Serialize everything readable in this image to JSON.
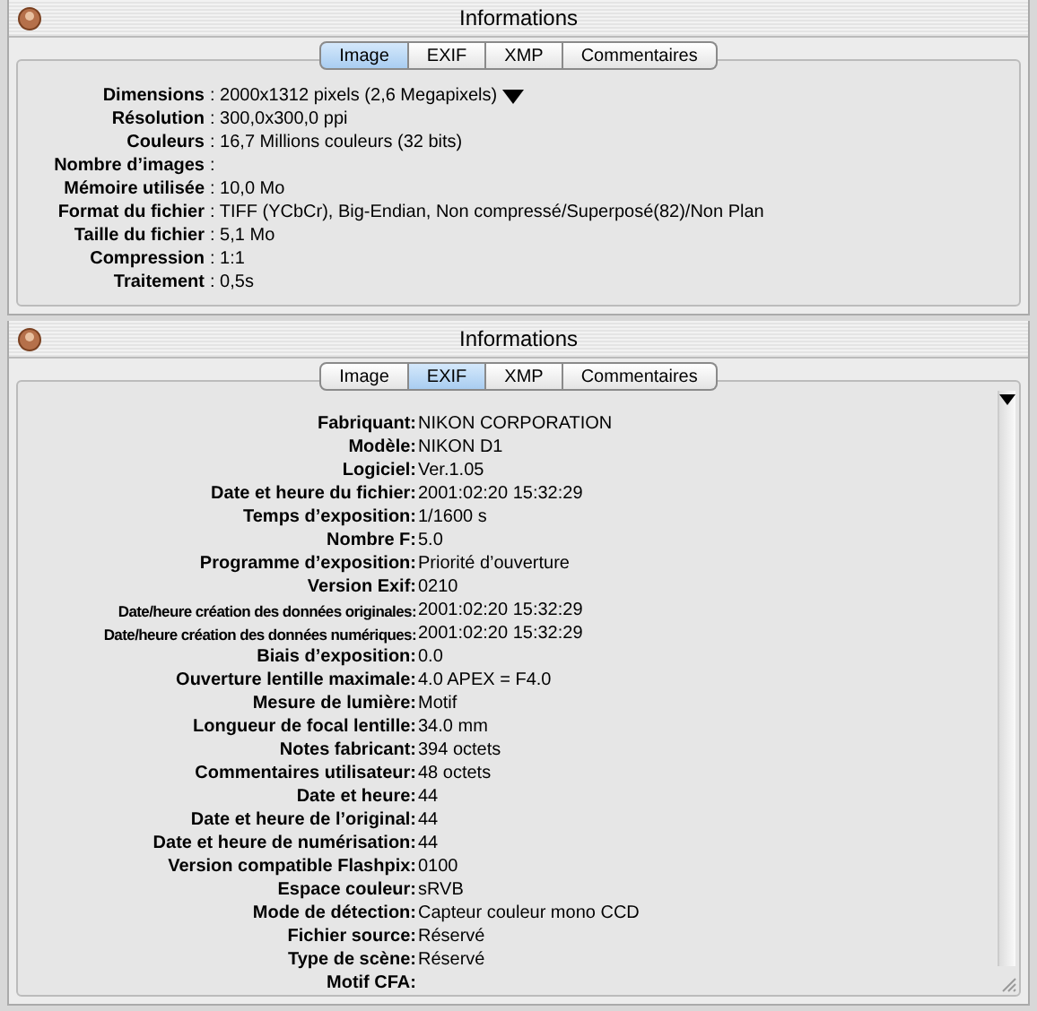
{
  "windows": [
    {
      "title": "Informations",
      "tabs": [
        {
          "label": "Image",
          "selected": true
        },
        {
          "label": "EXIF",
          "selected": false
        },
        {
          "label": "XMP",
          "selected": false
        },
        {
          "label": "Commentaires",
          "selected": false
        }
      ],
      "scrollbar": false,
      "rows": [
        {
          "label": "Dimensions",
          "value": ": 2000x1312 pixels (2,6 Megapixels)",
          "menu": true,
          "compact": false
        },
        {
          "label": "Résolution",
          "value": ": 300,0x300,0 ppi",
          "menu": false,
          "compact": false
        },
        {
          "label": "Couleurs",
          "value": ": 16,7 Millions couleurs (32 bits)",
          "menu": false,
          "compact": false
        },
        {
          "label": "Nombre d’images",
          "value": ":",
          "menu": false,
          "compact": false
        },
        {
          "label": "Mémoire utilisée",
          "value": ": 10,0 Mo",
          "menu": false,
          "compact": false
        },
        {
          "label": "Format du fichier",
          "value": ": TIFF (YCbCr), Big-Endian, Non compressé/Superposé(82)/Non Plan",
          "menu": false,
          "compact": false
        },
        {
          "label": "Taille du fichier",
          "value": ": 5,1 Mo",
          "menu": false,
          "compact": false
        },
        {
          "label": "Compression",
          "value": ": 1:1",
          "menu": false,
          "compact": false
        },
        {
          "label": "Traitement",
          "value": ": 0,5s",
          "menu": false,
          "compact": false
        }
      ]
    },
    {
      "title": "Informations",
      "tabs": [
        {
          "label": "Image",
          "selected": false
        },
        {
          "label": "EXIF",
          "selected": true
        },
        {
          "label": "XMP",
          "selected": false
        },
        {
          "label": "Commentaires",
          "selected": false
        }
      ],
      "scrollbar": true,
      "rows": [
        {
          "label": "Fabriquant:",
          "value": "NIKON CORPORATION",
          "menu": false,
          "compact": false
        },
        {
          "label": "Modèle:",
          "value": "NIKON D1",
          "menu": false,
          "compact": false
        },
        {
          "label": "Logiciel:",
          "value": "Ver.1.05",
          "menu": false,
          "compact": false
        },
        {
          "label": "Date et heure du fichier:",
          "value": "2001:02:20 15:32:29",
          "menu": false,
          "compact": false
        },
        {
          "label": "Temps d’exposition:",
          "value": "1/1600 s",
          "menu": false,
          "compact": false
        },
        {
          "label": "Nombre F:",
          "value": "5.0",
          "menu": false,
          "compact": false
        },
        {
          "label": "Programme d’exposition:",
          "value": "Priorité d’ouverture",
          "menu": false,
          "compact": false
        },
        {
          "label": "Version Exif:",
          "value": "0210",
          "menu": false,
          "compact": false
        },
        {
          "label": "Date/heure création des données originales:",
          "value": "2001:02:20 15:32:29",
          "menu": false,
          "compact": true
        },
        {
          "label": "Date/heure création des données numériques:",
          "value": "2001:02:20 15:32:29",
          "menu": false,
          "compact": true
        },
        {
          "label": "Biais d’exposition:",
          "value": "0.0",
          "menu": false,
          "compact": false
        },
        {
          "label": "Ouverture lentille maximale:",
          "value": "4.0 APEX = F4.0",
          "menu": false,
          "compact": false
        },
        {
          "label": "Mesure de lumière:",
          "value": "Motif",
          "menu": false,
          "compact": false
        },
        {
          "label": "Longueur de focal lentille:",
          "value": "34.0 mm",
          "menu": false,
          "compact": false
        },
        {
          "label": "Notes fabricant:",
          "value": "394 octets",
          "menu": false,
          "compact": false
        },
        {
          "label": "Commentaires utilisateur:",
          "value": "48 octets",
          "menu": false,
          "compact": false
        },
        {
          "label": "Date et heure:",
          "value": "44",
          "menu": false,
          "compact": false
        },
        {
          "label": "Date et heure de l’original:",
          "value": "44",
          "menu": false,
          "compact": false
        },
        {
          "label": "Date et heure de numérisation:",
          "value": "44",
          "menu": false,
          "compact": false
        },
        {
          "label": "Version compatible Flashpix:",
          "value": "0100",
          "menu": false,
          "compact": false
        },
        {
          "label": "Espace couleur:",
          "value": "sRVB",
          "menu": false,
          "compact": false
        },
        {
          "label": "Mode de détection:",
          "value": "Capteur couleur mono CCD",
          "menu": false,
          "compact": false
        },
        {
          "label": "Fichier source:",
          "value": "Réservé",
          "menu": false,
          "compact": false
        },
        {
          "label": "Type de scène:",
          "value": "Réservé",
          "menu": false,
          "compact": false
        },
        {
          "label": "Motif CFA:",
          "value": "",
          "menu": false,
          "compact": false
        }
      ]
    }
  ]
}
